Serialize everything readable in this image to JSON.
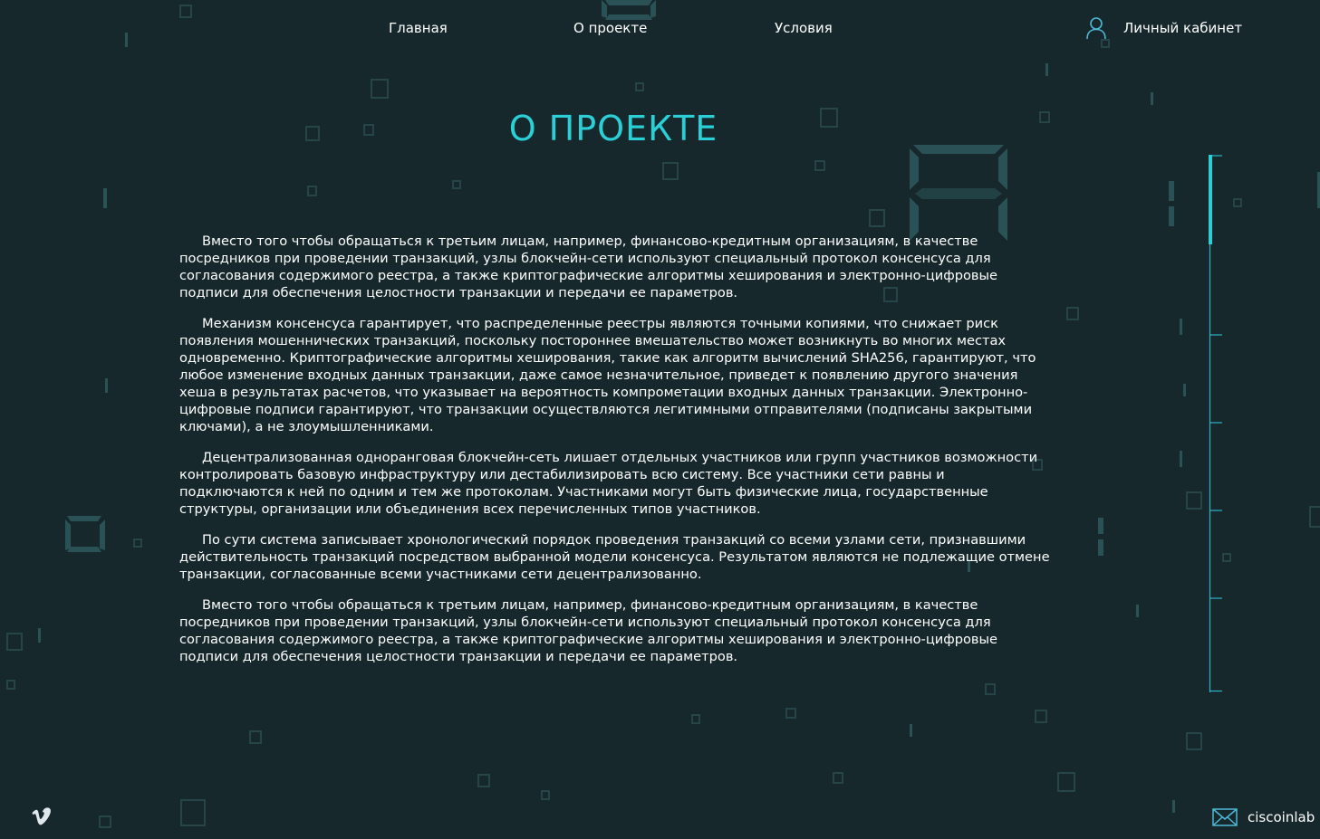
{
  "nav": {
    "home": "Главная",
    "about": "О проекте",
    "terms": "Условия",
    "account": "Личный кабинет"
  },
  "page": {
    "title": "О ПРОЕКТЕ"
  },
  "content": {
    "paragraphs": [
      "Вместо того чтобы обращаться к третьим лицам, например, финансово-кредитным организациям, в качестве посредников при проведении транзакций, узлы блокчейн-сети используют специальный протокол консенсуса для согласования содержимого реестра, а также криптографические алгоритмы хеширования и электронно-цифровые подписи для обеспечения целостности транзакции и передачи ее параметров.",
      "Механизм консенсуса гарантирует, что распределенные реестры являются точными копиями, что снижает риск появления мошеннических транзакций, поскольку постороннее вмешательство может возникнуть во многих местах одновременно. Криптографические алгоритмы хеширования, такие как алгоритм вычислений SHA256, гарантируют, что любое изменение входных данных транзакции, даже самое незначительное, приведет к появлению другого значения хеша в результатах расчетов, что указывает на вероятность компрометации входных данных транзакции. Электронно-цифровые подписи гарантируют, что транзакции осуществляются легитимными отправителями (подписаны закрытыми ключами), а не злоумышленниками.",
      "Децентрализованная одноранговая блокчейн-сеть лишает отдельных участников или групп участников возможности контролировать базовую инфраструктуру или дестабилизировать всю систему. Все участники сети равны и подключаются к ней по одним и тем же протоколам. Участниками могут быть физические лица, государственные структуры, организации или объединения всех перечисленных типов участников.",
      "По сути система записывает хронологический порядок проведения транзакций со всеми узлами сети, признавшими действительность транзакций посредством выбранной модели консенсуса. Результатом являются не подлежащие отмене транзакции, согласованные всеми участниками сети децентрализованно.",
      "Вместо того чтобы обращаться к третьим лицам, например, финансово-кредитным организациям, в качестве посредников при проведении транзакций, узлы блокчейн-сети используют специальный протокол консенсуса для согласования содержимого реестра, а также криптографические алгоритмы хеширования и электронно-цифровые подписи для обеспечения целостности транзакции и передачи ее параметров."
    ]
  },
  "scroll_nav": {
    "sections": 6,
    "active_index": 0
  },
  "footer": {
    "social_icon": "vimeo-icon",
    "email_icon": "mail-icon",
    "email": "ciscoinlab"
  },
  "colors": {
    "background": "#16282c",
    "accent": "#2ad0d6",
    "decor": "#2e5a5e",
    "text": "#ffffff"
  }
}
